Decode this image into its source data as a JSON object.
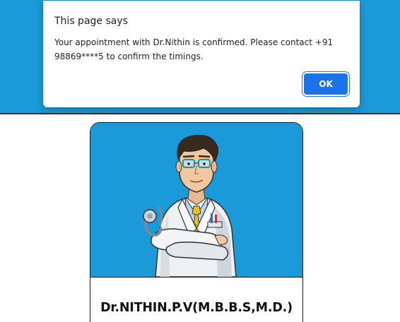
{
  "colors": {
    "banner": "#1a9ad9",
    "card_image_background": "#1a9ad9",
    "dialog_button": "#1a73e8"
  },
  "dialog": {
    "title": "This page says",
    "message": "Your appointment with Dr.Nithin is confirmed. Please contact +91 98869****5 to confirm the timings.",
    "ok_label": "OK"
  },
  "card": {
    "image_icon": "doctor-illustration-icon",
    "doctor_name": "Dr.NITHIN.P.V(M.B.B.S,M.D.)"
  }
}
